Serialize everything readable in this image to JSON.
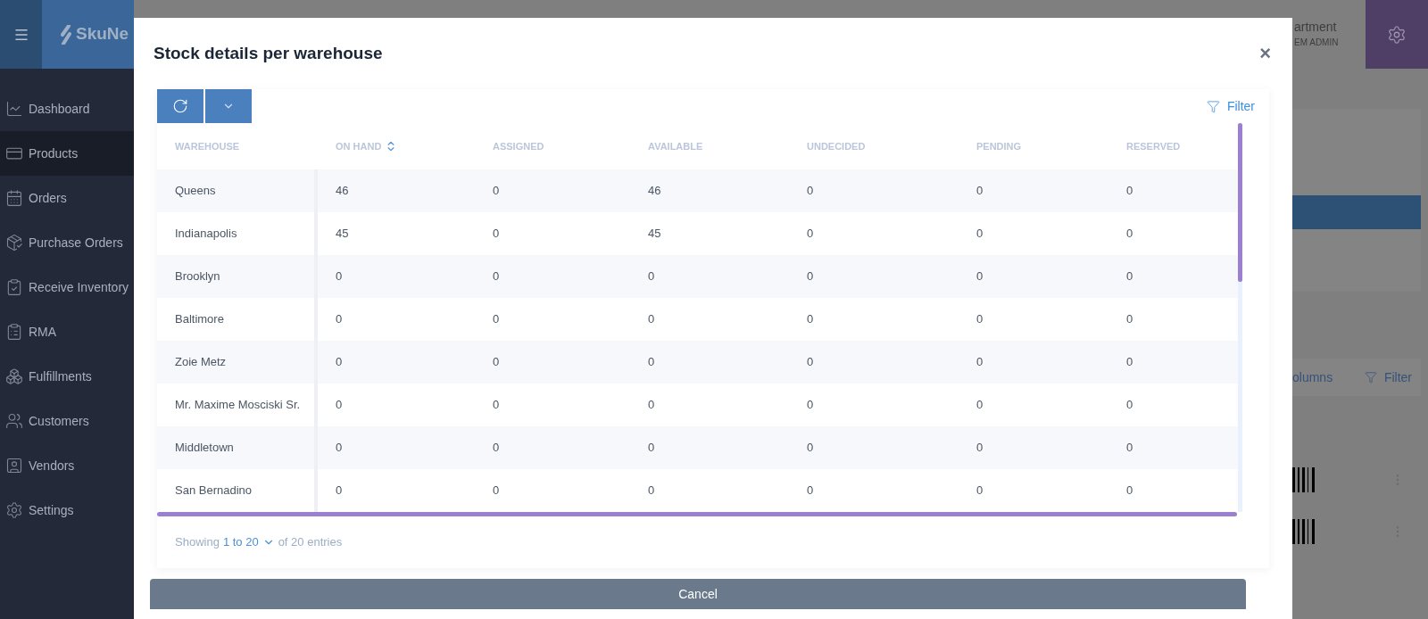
{
  "app": {
    "logo": "SkuNe",
    "user_name": "artment",
    "user_role": "EM ADMIN"
  },
  "sidebar": {
    "items": [
      {
        "label": "Dashboard",
        "selected": false
      },
      {
        "label": "Products",
        "selected": true
      },
      {
        "label": "Orders",
        "selected": false
      },
      {
        "label": "Purchase Orders",
        "selected": false
      },
      {
        "label": "Receive Inventory",
        "selected": false
      },
      {
        "label": "RMA",
        "selected": false
      },
      {
        "label": "Fulfillments",
        "selected": false
      },
      {
        "label": "Customers",
        "selected": false
      },
      {
        "label": "Vendors",
        "selected": false
      },
      {
        "label": "Settings",
        "selected": false
      }
    ]
  },
  "background": {
    "columns_link": "olumns",
    "filter_link": "Filter"
  },
  "modal": {
    "title": "Stock details per warehouse",
    "close": "×",
    "filter": "Filter",
    "table": {
      "columns": [
        {
          "label": "WAREHOUSE",
          "sortable": false
        },
        {
          "label": "ON HAND",
          "sortable": true
        },
        {
          "label": "ASSIGNED",
          "sortable": false
        },
        {
          "label": "AVAILABLE",
          "sortable": false
        },
        {
          "label": "UNDECIDED",
          "sortable": false
        },
        {
          "label": "PENDING",
          "sortable": false
        },
        {
          "label": "RESERVED",
          "sortable": false
        }
      ],
      "rows": [
        [
          "Queens",
          "46",
          "0",
          "46",
          "0",
          "0",
          "0"
        ],
        [
          "Indianapolis",
          "45",
          "0",
          "45",
          "0",
          "0",
          "0"
        ],
        [
          "Brooklyn",
          "0",
          "0",
          "0",
          "0",
          "0",
          "0"
        ],
        [
          "Baltimore",
          "0",
          "0",
          "0",
          "0",
          "0",
          "0"
        ],
        [
          "Zoie Metz",
          "0",
          "0",
          "0",
          "0",
          "0",
          "0"
        ],
        [
          "Mr. Maxime Mosciski Sr.",
          "0",
          "0",
          "0",
          "0",
          "0",
          "0"
        ],
        [
          "Middletown",
          "0",
          "0",
          "0",
          "0",
          "0",
          "0"
        ],
        [
          "San Bernadino",
          "0",
          "0",
          "0",
          "0",
          "0",
          "0"
        ]
      ]
    },
    "footer": {
      "showing": "Showing",
      "range": "1 to 20",
      "total": "of 20 entries"
    },
    "cancel": "Cancel"
  }
}
